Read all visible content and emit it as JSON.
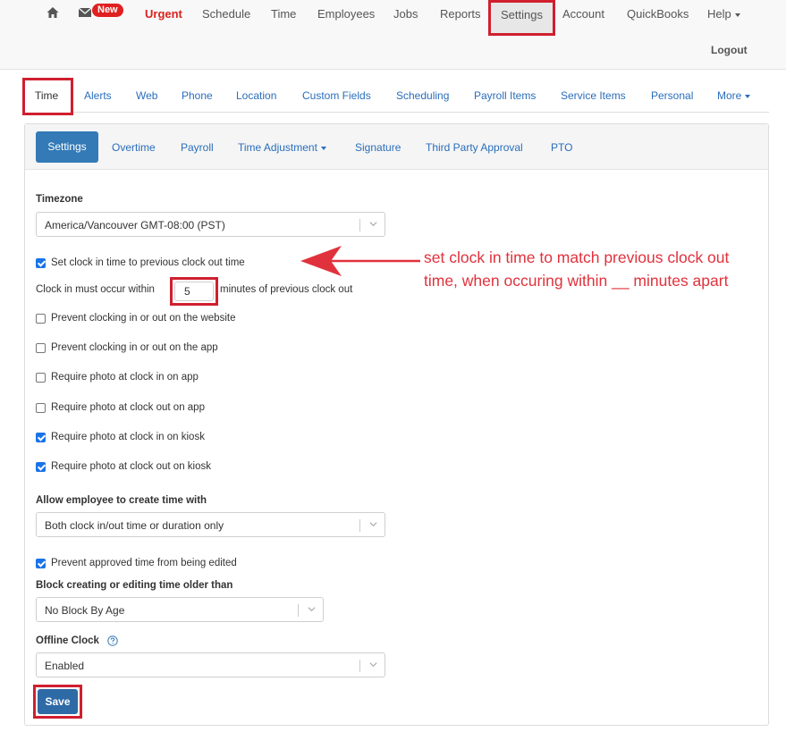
{
  "topnav": {
    "new_badge": "New",
    "items": [
      "Urgent",
      "Schedule",
      "Time",
      "Employees",
      "Jobs",
      "Reports",
      "Settings",
      "Account",
      "QuickBooks",
      "Help"
    ],
    "logout": "Logout"
  },
  "tabs": [
    "Time",
    "Alerts",
    "Web",
    "Phone",
    "Location",
    "Custom Fields",
    "Scheduling",
    "Payroll Items",
    "Service Items",
    "Personal",
    "More"
  ],
  "subtabs": [
    "Settings",
    "Overtime",
    "Payroll",
    "Time Adjustment",
    "Signature",
    "Third Party Approval",
    "PTO"
  ],
  "form": {
    "timezone_label": "Timezone",
    "timezone_value": "America/Vancouver GMT-08:00 (PST)",
    "checkbox_set_clock": "Set clock in time to previous clock out time",
    "clock_in_prefix": "Clock in must occur within",
    "clock_in_minutes": "5",
    "clock_in_suffix": "minutes of previous clock out",
    "checkboxes": [
      {
        "label": "Prevent clocking in or out on the website",
        "checked": false
      },
      {
        "label": "Prevent clocking in or out on the app",
        "checked": false
      },
      {
        "label": "Require photo at clock in on app",
        "checked": false
      },
      {
        "label": "Require photo at clock out on app",
        "checked": false
      },
      {
        "label": "Require photo at clock in on kiosk",
        "checked": true
      },
      {
        "label": "Require photo at clock out on kiosk",
        "checked": true
      }
    ],
    "allow_label": "Allow employee to create time with",
    "allow_value": "Both clock in/out time or duration only",
    "prevent_approved": "Prevent approved time from being edited",
    "block_label": "Block creating or editing time older than",
    "block_value": "No Block By Age",
    "offline_label": "Offline Clock",
    "offline_value": "Enabled",
    "save": "Save"
  },
  "annotation": {
    "line1": "set clock in time to match previous clock out",
    "line2": "time, when occuring within __ minutes apart",
    "color": "#e0323c"
  }
}
